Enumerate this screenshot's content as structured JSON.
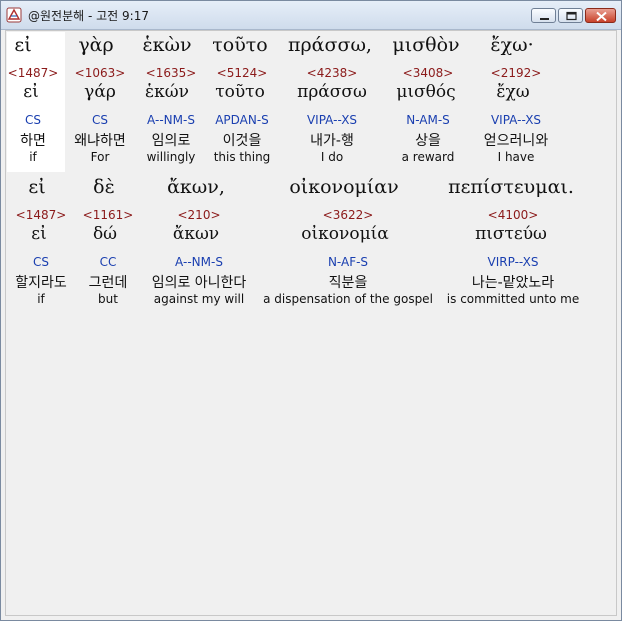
{
  "window": {
    "title": "@원전분해 - 고전 9:17",
    "buttons": {
      "minimize": "minimize",
      "maximize": "maximize",
      "close": "close"
    },
    "icons": {
      "app": "app-logo-icon"
    }
  },
  "colors": {
    "strong": "#8b1a1a",
    "morph": "#1a3fb0",
    "text": "#111111"
  },
  "rows": [
    {
      "words": [
        {
          "greek": "εἰ",
          "strong": "<1487>",
          "lemma": "εἰ",
          "morph": "CS",
          "korean": "하면",
          "english": "if"
        },
        {
          "greek": "γὰρ",
          "strong": "<1063>",
          "lemma": "γάρ",
          "morph": "CS",
          "korean": "왜냐하면",
          "english": "For"
        },
        {
          "greek": "ἑκὼν",
          "strong": "<1635>",
          "lemma": "ἑκών",
          "morph": "A--NM-S",
          "korean": "임의로",
          "english": "willingly"
        },
        {
          "greek": "τοῦτο",
          "strong": "<5124>",
          "lemma": "τοῦτο",
          "morph": "APDAN-S",
          "korean": "이것을",
          "english": "this thing"
        },
        {
          "greek": "πράσσω,",
          "strong": "<4238>",
          "lemma": "πράσσω",
          "morph": "VIPA--XS",
          "korean": "내가-행",
          "english": "I do"
        },
        {
          "greek": "μισθὸν",
          "strong": "<3408>",
          "lemma": "μισθός",
          "morph": "N-AM-S",
          "korean": "상을",
          "english": "a reward"
        },
        {
          "greek": "ἔχω·",
          "strong": "<2192>",
          "lemma": "ἔχω",
          "morph": "VIPA--XS",
          "korean": "얻으러니와",
          "english": "I have"
        }
      ]
    },
    {
      "words": [
        {
          "greek": "εἰ",
          "strong": "<1487>",
          "lemma": "εἰ",
          "morph": "CS",
          "korean": "할지라도",
          "english": "if"
        },
        {
          "greek": "δὲ",
          "strong": "<1161>",
          "lemma": "δώ",
          "morph": "CC",
          "korean": "그런데",
          "english": "but"
        },
        {
          "greek": "ἄκων,",
          "strong": "<210>",
          "lemma": "ἄκων",
          "morph": "A--NM-S",
          "korean": "임의로 아니한다",
          "english": "against my will"
        },
        {
          "greek": "οἰκονομίαν",
          "strong": "<3622>",
          "lemma": "οἰκονομία",
          "morph": "N-AF-S",
          "korean": "직분을",
          "english": "a dispensation of the gospel"
        },
        {
          "greek": "πεπίστευμαι.",
          "strong": "<4100>",
          "lemma": "πιστεύω",
          "morph": "VIRP--XS",
          "korean": "나는-맡았노라",
          "english": "is committed unto me"
        }
      ]
    }
  ]
}
